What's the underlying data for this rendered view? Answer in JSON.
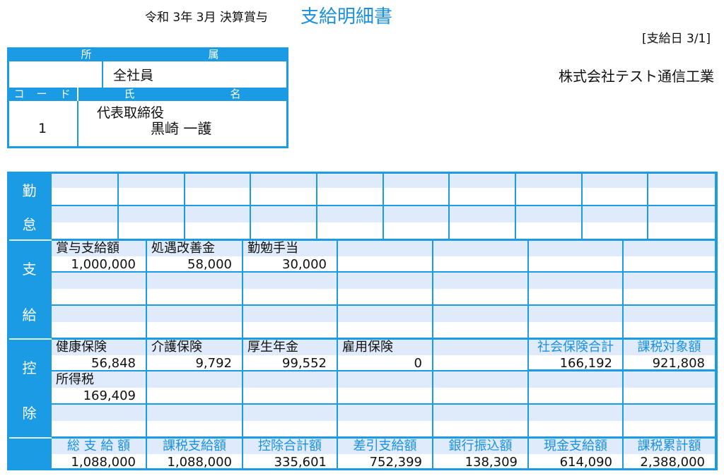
{
  "header": {
    "period": "令和 3年 3月 決算賞与",
    "title": "支給明細書",
    "pay_date": "[支給日 3/1]",
    "company": "株式会社テスト通信工業"
  },
  "employee": {
    "dept_header": [
      "所",
      "属"
    ],
    "dept_name": "全社員",
    "code_header": [
      "コ",
      "ー",
      "ド"
    ],
    "name_header": [
      "氏",
      "名"
    ],
    "code": "1",
    "position": "代表取締役",
    "name": "黒崎 一護"
  },
  "sections": {
    "attendance": [
      "勤",
      "怠"
    ],
    "payment": [
      "支",
      "給"
    ],
    "deduction": [
      "控",
      "除"
    ]
  },
  "payment_rows": [
    [
      {
        "label": "賞与支給額",
        "value": "1,000,000"
      },
      {
        "label": "処遇改善金",
        "value": "58,000"
      },
      {
        "label": "勤勉手当",
        "value": "30,000"
      }
    ],
    [],
    []
  ],
  "deduction_rows": [
    [
      {
        "label": "健康保険",
        "value": "56,848"
      },
      {
        "label": "介護保険",
        "value": "9,792"
      },
      {
        "label": "厚生年金",
        "value": "99,552"
      },
      {
        "label": "雇用保険",
        "value": "0"
      }
    ],
    [
      {
        "label": "所得税",
        "value": "169,409"
      }
    ],
    []
  ],
  "deduction_summary": [
    {
      "label": "社会保険合計",
      "value": "166,192"
    },
    {
      "label": "課税対象額",
      "value": "921,808"
    }
  ],
  "totals": [
    {
      "label": "総 支 給 額",
      "value": "1,088,000"
    },
    {
      "label": "課税支給額",
      "value": "1,088,000"
    },
    {
      "label": "控除合計額",
      "value": "335,601"
    },
    {
      "label": "差引支給額",
      "value": "752,399"
    },
    {
      "label": "銀行振込額",
      "value": "138,309"
    },
    {
      "label": "現金支給額",
      "value": "614,090"
    },
    {
      "label": "課税累計額",
      "value": "2,388,000"
    }
  ],
  "colors": {
    "accent": "#1b9be3",
    "label_text": "#1a90e0",
    "stripe": "#dfebfb"
  }
}
